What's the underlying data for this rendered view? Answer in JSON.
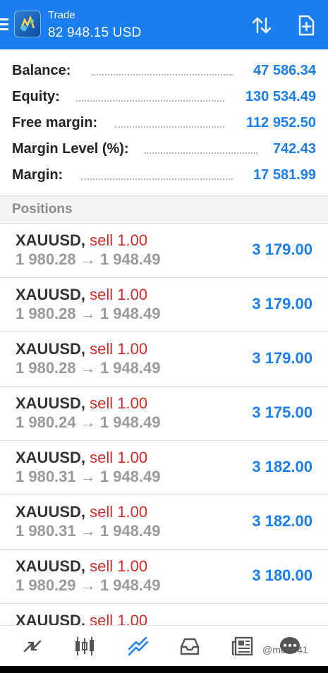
{
  "header": {
    "title": "Trade",
    "subtitle": "82 948.15 USD"
  },
  "summary": [
    {
      "label": "Balance:",
      "value": "47 586.34"
    },
    {
      "label": "Equity:",
      "value": "130 534.49"
    },
    {
      "label": "Free margin:",
      "value": "112 952.50"
    },
    {
      "label": "Margin Level (%):",
      "value": "742.43"
    },
    {
      "label": "Margin:",
      "value": "17 581.99"
    }
  ],
  "positions_label": "Positions",
  "positions": [
    {
      "symbol": "XAUUSD,",
      "side": "sell 1.00",
      "prices": "1 980.28 → 1 948.49",
      "profit": "3 179.00"
    },
    {
      "symbol": "XAUUSD,",
      "side": "sell 1.00",
      "prices": "1 980.28 → 1 948.49",
      "profit": "3 179.00"
    },
    {
      "symbol": "XAUUSD,",
      "side": "sell 1.00",
      "prices": "1 980.28 → 1 948.49",
      "profit": "3 179.00"
    },
    {
      "symbol": "XAUUSD,",
      "side": "sell 1.00",
      "prices": "1 980.24 → 1 948.49",
      "profit": "3 175.00"
    },
    {
      "symbol": "XAUUSD,",
      "side": "sell 1.00",
      "prices": "1 980.31 → 1 948.49",
      "profit": "3 182.00"
    },
    {
      "symbol": "XAUUSD,",
      "side": "sell 1.00",
      "prices": "1 980.31 → 1 948.49",
      "profit": "3 182.00"
    },
    {
      "symbol": "XAUUSD,",
      "side": "sell 1.00",
      "prices": "1 980.29 → 1 948.49",
      "profit": "3 180.00"
    },
    {
      "symbol": "XAUUSD,",
      "side": "sell 1.00",
      "prices": "",
      "profit": ""
    }
  ],
  "bottom_nav": [
    {
      "icon": "quotes-icon"
    },
    {
      "icon": "chart-icon"
    },
    {
      "icon": "trade-icon",
      "active": true
    },
    {
      "icon": "history-icon"
    },
    {
      "icon": "news-icon"
    },
    {
      "icon": "messages-icon"
    }
  ],
  "watermark": "@mdd941",
  "colors": {
    "accent": "#1a7ef0",
    "sell": "#d62b2b",
    "muted": "#9a9a9a"
  }
}
